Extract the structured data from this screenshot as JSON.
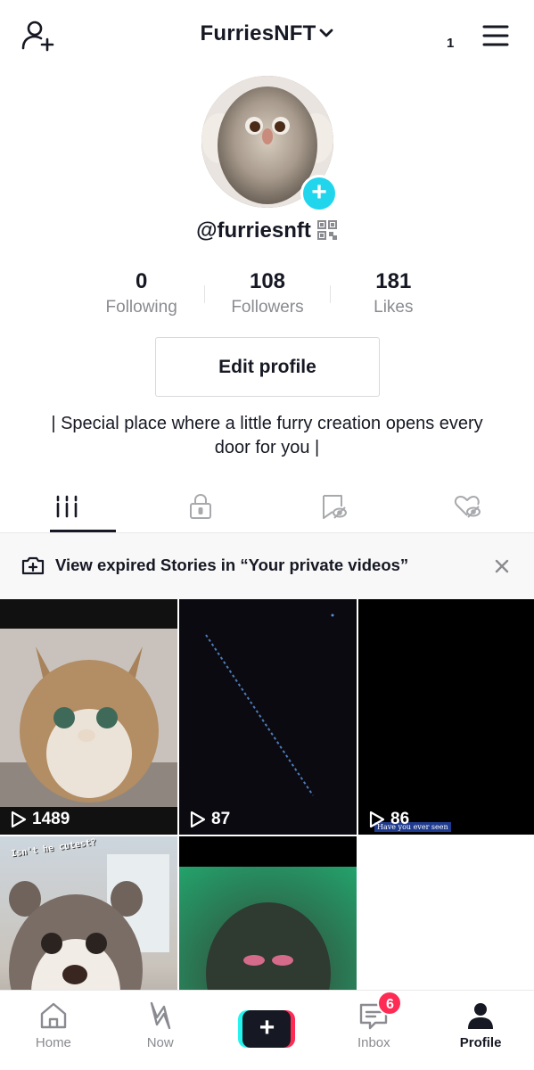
{
  "header": {
    "username": "FurriesNFT",
    "notification_count": "1"
  },
  "profile": {
    "handle": "@furriesnft",
    "bio": "| Special place where a little furry creation opens every door for you |",
    "edit_button": "Edit profile"
  },
  "stats": [
    {
      "value": "0",
      "label": "Following"
    },
    {
      "value": "108",
      "label": "Followers"
    },
    {
      "value": "181",
      "label": "Likes"
    }
  ],
  "tabs": [
    {
      "icon": "grid-icon",
      "active": true
    },
    {
      "icon": "lock-icon",
      "active": false
    },
    {
      "icon": "bookmark-hidden-icon",
      "active": false
    },
    {
      "icon": "heart-hidden-icon",
      "active": false
    }
  ],
  "banner": {
    "text": "View expired Stories in “Your private videos”"
  },
  "videos": [
    {
      "views": "1489"
    },
    {
      "views": "87"
    },
    {
      "views": "86"
    },
    {
      "views": ""
    },
    {
      "views": ""
    }
  ],
  "video_overlays": {
    "v4_caption": "Isn't he cutest?",
    "v3_caption": "Have you ever seen"
  },
  "bottom_nav": [
    {
      "label": "Home",
      "icon": "home-icon"
    },
    {
      "label": "Now",
      "icon": "now-icon"
    },
    {
      "label": "",
      "icon": "plus-icon"
    },
    {
      "label": "Inbox",
      "icon": "inbox-icon",
      "badge": "6"
    },
    {
      "label": "Profile",
      "icon": "person-icon",
      "active": true
    }
  ],
  "colors": {
    "text": "#161823",
    "secondary": "#8a8b91",
    "accent_cyan": "#20d5ec",
    "accent_red": "#fe2c55"
  }
}
